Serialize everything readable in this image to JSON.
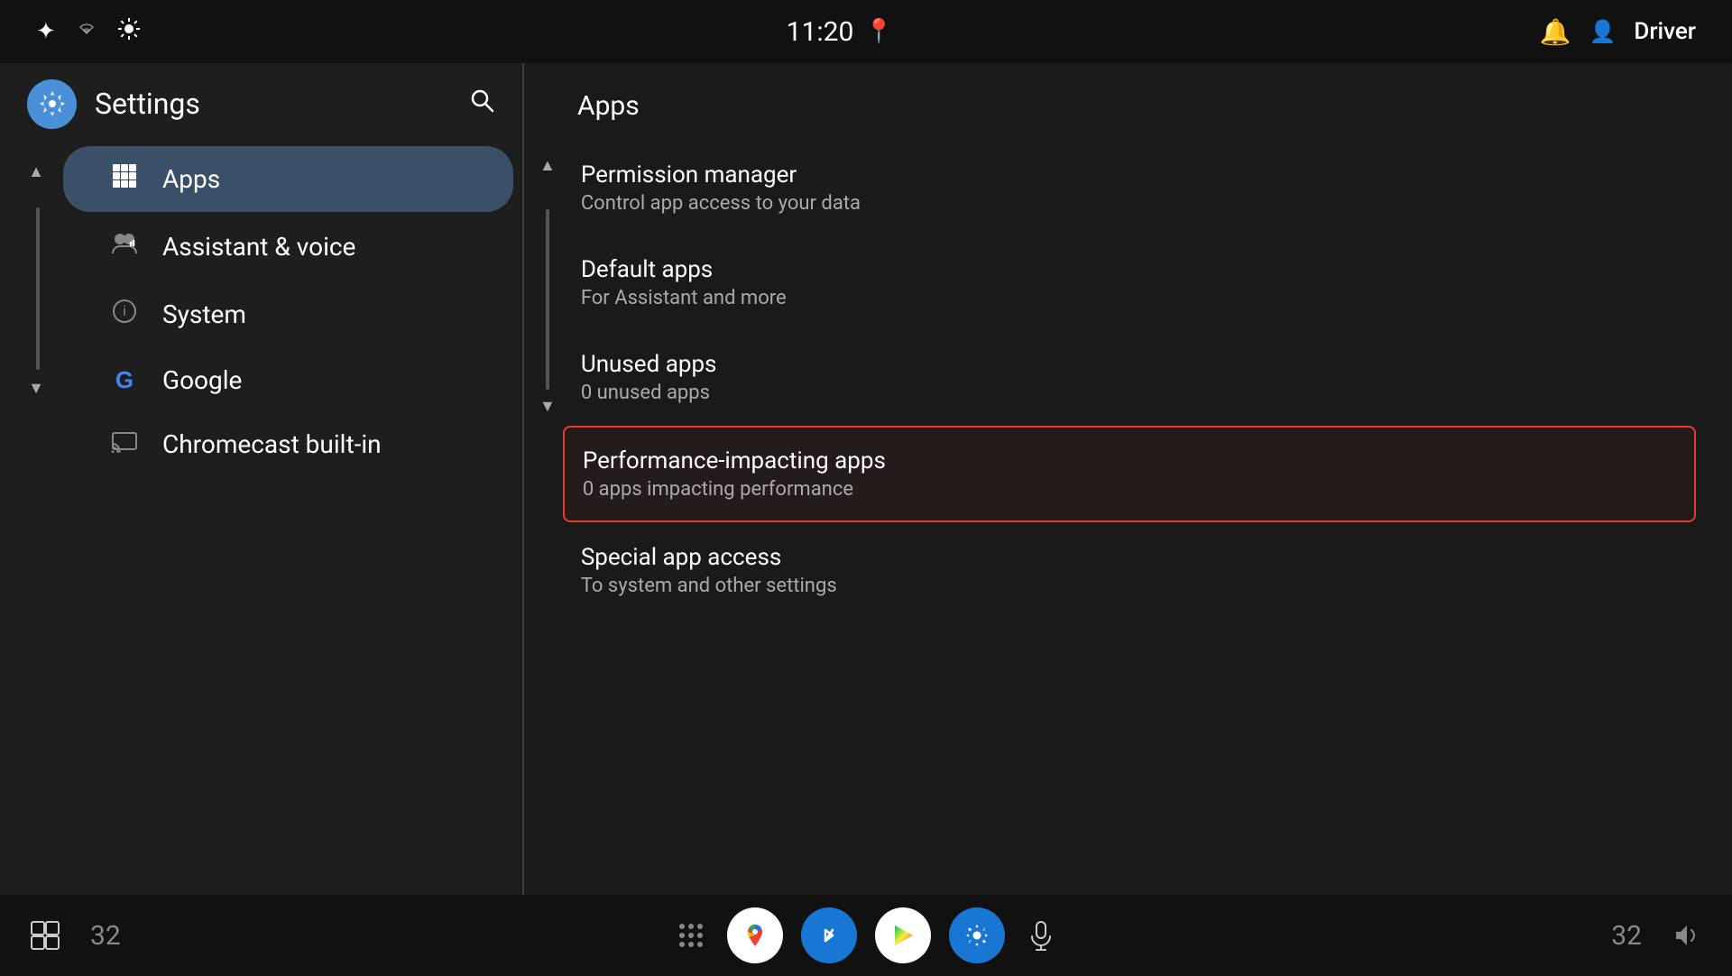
{
  "statusBar": {
    "time": "11:20",
    "user": "Driver",
    "icons": {
      "bluetooth": "✦",
      "wifi": "▽",
      "brightness": "⊙",
      "location": "📍",
      "bell": "🔔",
      "person": "👤"
    }
  },
  "sidebar": {
    "title": "Settings",
    "collapseUp": "▲",
    "collapseDown": "▼",
    "activeItem": "apps",
    "items": [
      {
        "id": "apps",
        "label": "Apps",
        "icon": "⊞"
      },
      {
        "id": "assistant",
        "label": "Assistant & voice",
        "icon": "👥"
      },
      {
        "id": "system",
        "label": "System",
        "icon": "ℹ"
      },
      {
        "id": "google",
        "label": "Google",
        "icon": "G"
      },
      {
        "id": "chromecast",
        "label": "Chromecast built-in",
        "icon": "⬚"
      }
    ]
  },
  "content": {
    "pageTitle": "Apps",
    "collapseUp": "▲",
    "collapseDown": "▼",
    "items": [
      {
        "id": "permission-manager",
        "title": "Permission manager",
        "subtitle": "Control app access to your data",
        "selected": false
      },
      {
        "id": "default-apps",
        "title": "Default apps",
        "subtitle": "For Assistant and more",
        "selected": false
      },
      {
        "id": "unused-apps",
        "title": "Unused apps",
        "subtitle": "0 unused apps",
        "selected": false
      },
      {
        "id": "performance-impacting-apps",
        "title": "Performance-impacting apps",
        "subtitle": "0 apps impacting performance",
        "selected": true
      },
      {
        "id": "special-app-access",
        "title": "Special app access",
        "subtitle": "To system and other settings",
        "selected": false
      }
    ]
  },
  "taskbar": {
    "leftNumber": "32",
    "rightNumber": "32",
    "apps": [
      {
        "id": "maps",
        "label": "Maps"
      },
      {
        "id": "bluetooth",
        "label": "Bluetooth"
      },
      {
        "id": "play",
        "label": "Play Store"
      },
      {
        "id": "settings",
        "label": "Settings"
      }
    ],
    "micIcon": "🎤",
    "volumeIcon": "🔊"
  },
  "colors": {
    "accent": "#4a90d9",
    "selectedBorder": "#e53935",
    "activeNavBg": "#3a5068",
    "background": "#1a1a1a",
    "surface": "#1e1e1e"
  }
}
